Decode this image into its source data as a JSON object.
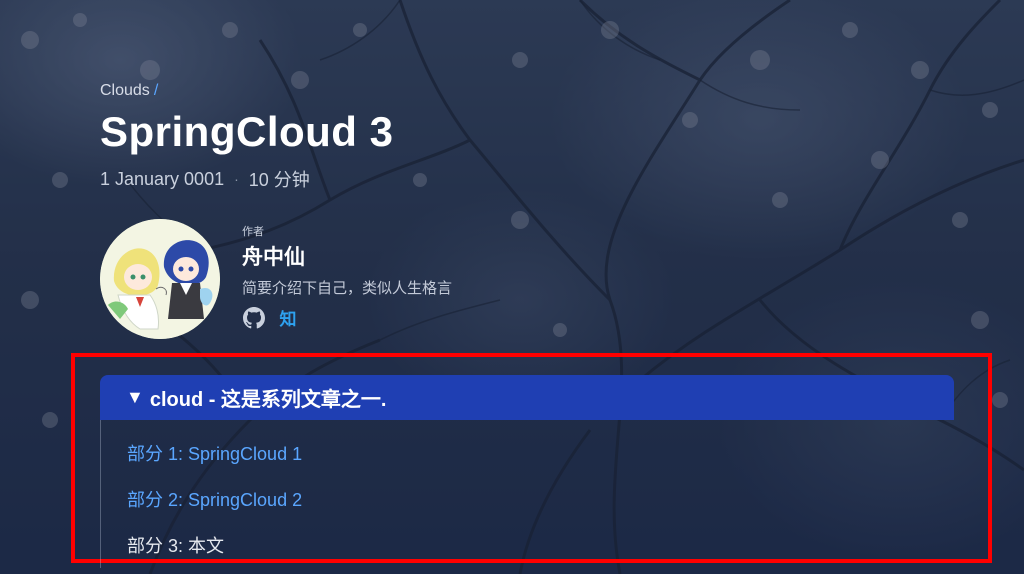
{
  "breadcrumb": {
    "section": "Clouds",
    "separator": "/"
  },
  "post": {
    "title": "SpringCloud 3",
    "date": "1 January 0001",
    "separator": "·",
    "reading_time": "10 分钟"
  },
  "author": {
    "caption": "作者",
    "name": "舟中仙",
    "bio": "简要介绍下自己，类似人生格言",
    "social": [
      {
        "icon": "github-icon",
        "label": "GitHub"
      },
      {
        "icon": "zhihu-icon",
        "label": "知"
      }
    ]
  },
  "series": {
    "toggle": "▼",
    "heading": "cloud - 这是系列文章之一.",
    "items": [
      {
        "label": "部分 1: SpringCloud 1",
        "current": false
      },
      {
        "label": "部分 2: SpringCloud 2",
        "current": false
      },
      {
        "label": "部分 3: 本文",
        "current": true
      }
    ]
  },
  "colors": {
    "series_header": "#1f3fb3",
    "link": "#5aa6ff",
    "highlight_border": "#ff0000"
  }
}
